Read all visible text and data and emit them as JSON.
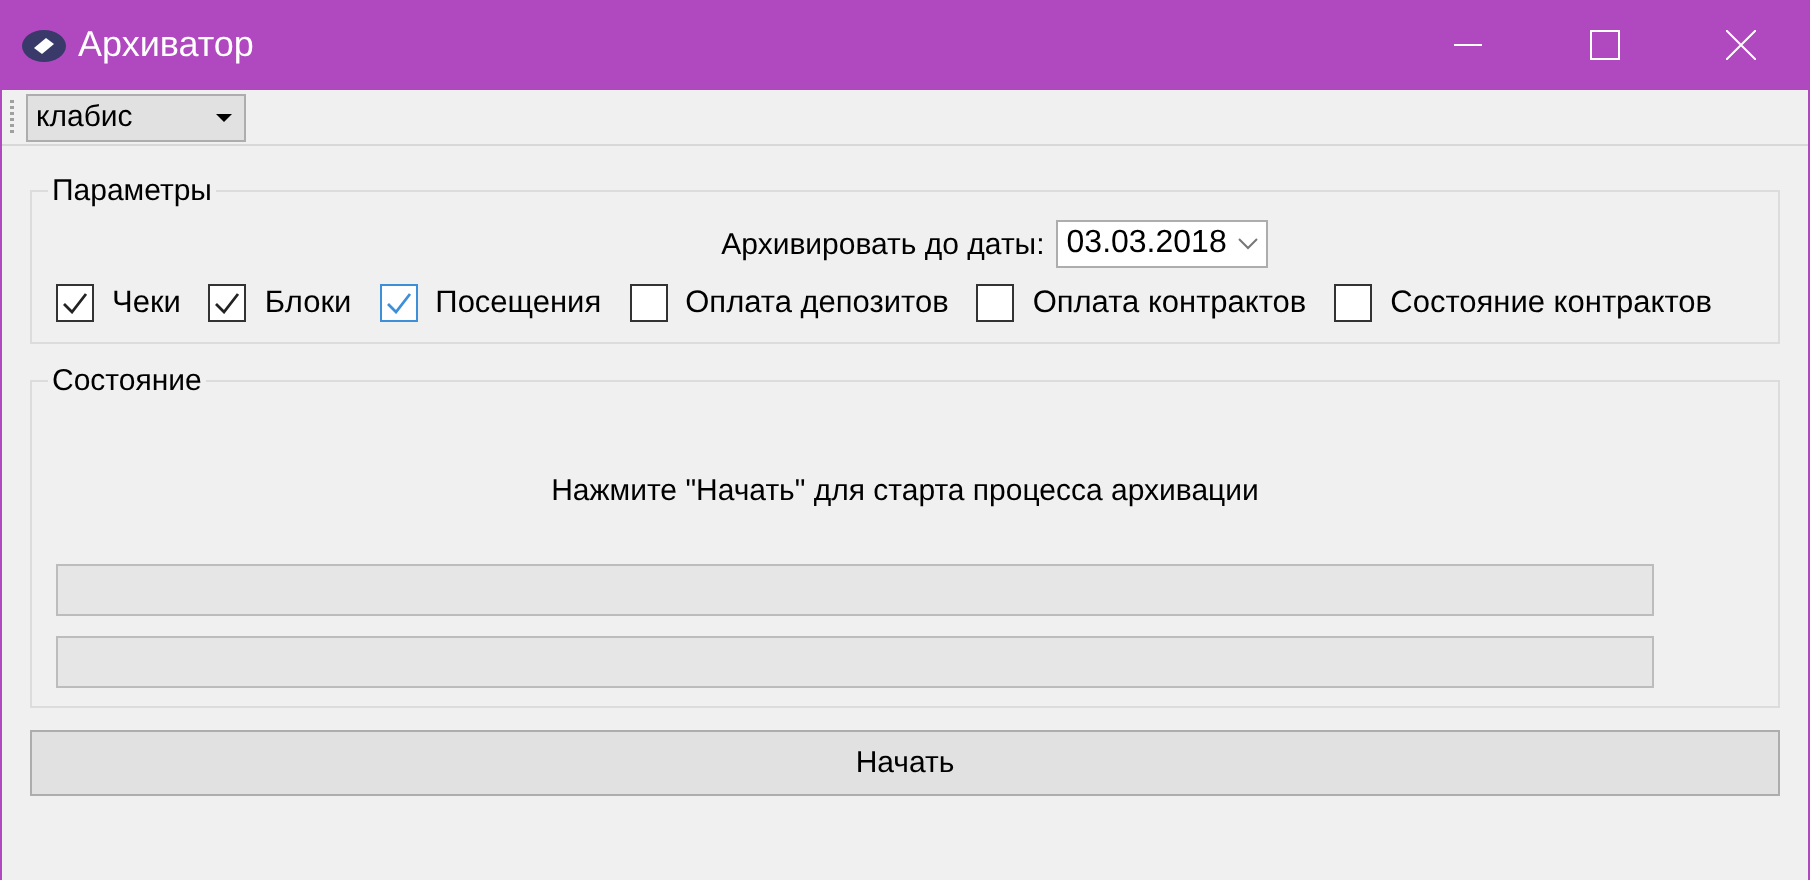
{
  "window": {
    "title": "Архиватор"
  },
  "toolbar": {
    "combo": {
      "value": "клабис"
    }
  },
  "parameters": {
    "title": "Параметры",
    "date_label": "Архивировать до даты:",
    "date_value": "03.03.2018",
    "checkboxes": [
      {
        "label": "Чеки",
        "checked": true,
        "focused": false
      },
      {
        "label": "Блоки",
        "checked": true,
        "focused": false
      },
      {
        "label": "Посещения",
        "checked": true,
        "focused": true
      },
      {
        "label": "Оплата депозитов",
        "checked": false,
        "focused": false
      },
      {
        "label": "Оплата контрактов",
        "checked": false,
        "focused": false
      },
      {
        "label": "Состояние контрактов",
        "checked": false,
        "focused": false
      }
    ]
  },
  "status": {
    "title": "Состояние",
    "message": "Нажмите \"Начать\" для старта процесса архивации",
    "progress": [
      {
        "level": 0
      },
      {
        "level": 0
      }
    ]
  },
  "start_button": "Начать"
}
